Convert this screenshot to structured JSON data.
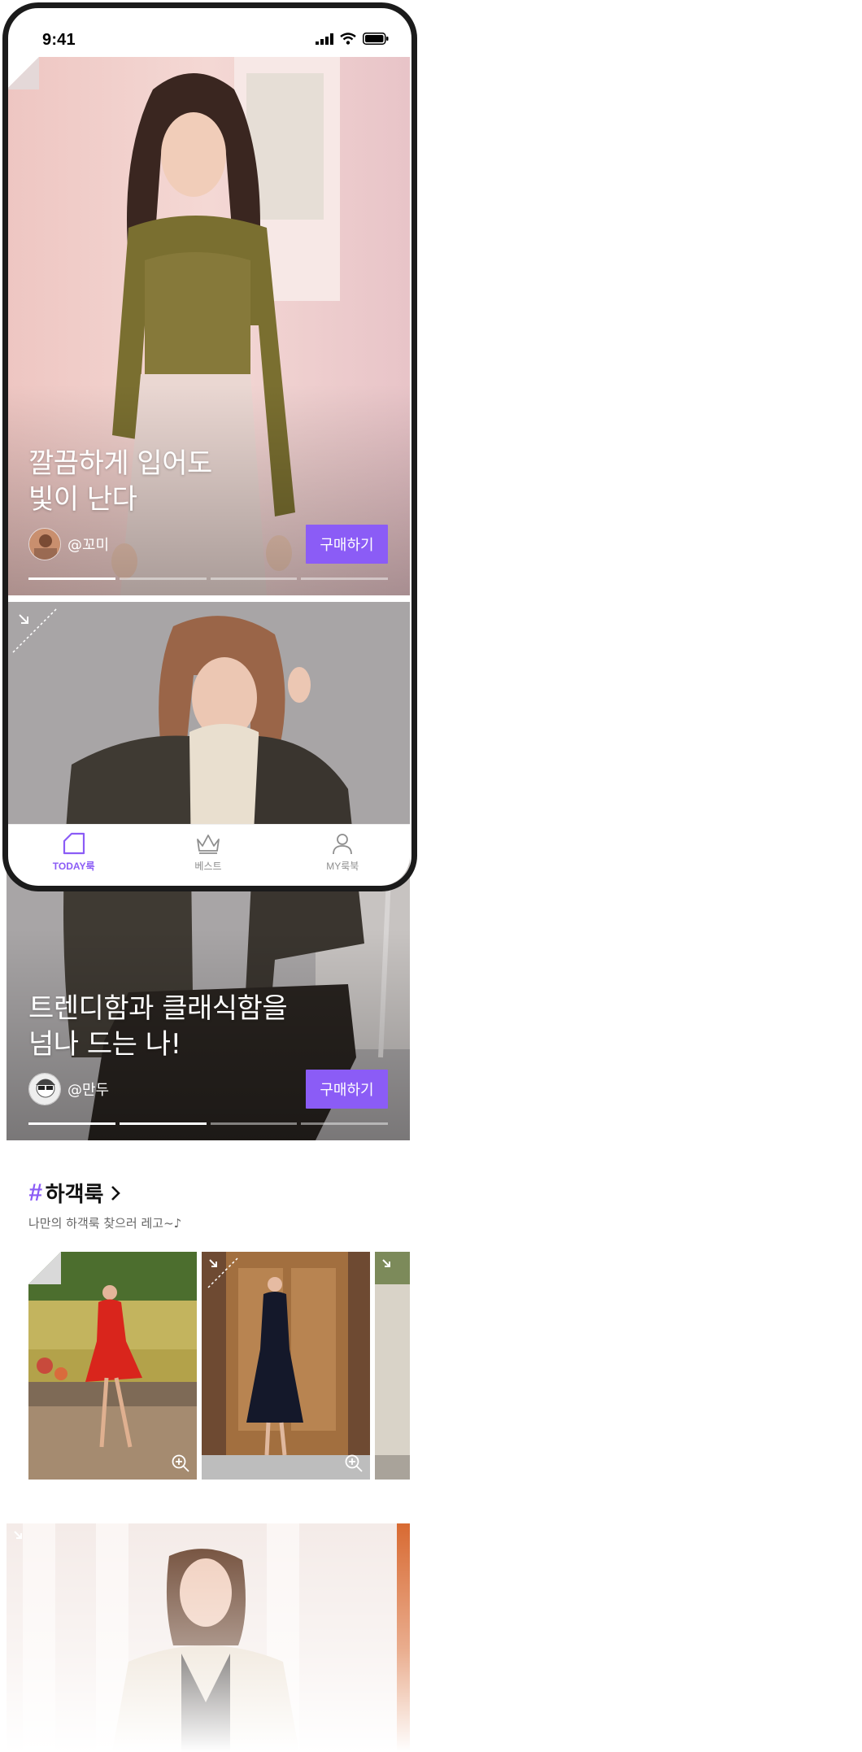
{
  "status_bar": {
    "time": "9:41"
  },
  "feed": [
    {
      "title": "깔끔하게 입어도\n빛이 난다",
      "author": "@꼬미",
      "buy_label": "구매하기"
    },
    {
      "title": "트렌디함과 클래식함을\n넘나 드는 나!",
      "author": "@만두",
      "buy_label": "구매하기"
    }
  ],
  "tab_bar": {
    "tabs": [
      {
        "label": "TODAY룩",
        "icon": "today-look-icon",
        "active": true
      },
      {
        "label": "베스트",
        "icon": "crown-icon",
        "active": false
      },
      {
        "label": "MY룩북",
        "icon": "person-icon",
        "active": false
      }
    ]
  },
  "section": {
    "hash": "#",
    "title": "하객룩",
    "subtitle": "나만의 하객룩 찾으러 레고~♪"
  },
  "colors": {
    "accent": "#8b5cf6",
    "frame": "#1b1b1b"
  }
}
